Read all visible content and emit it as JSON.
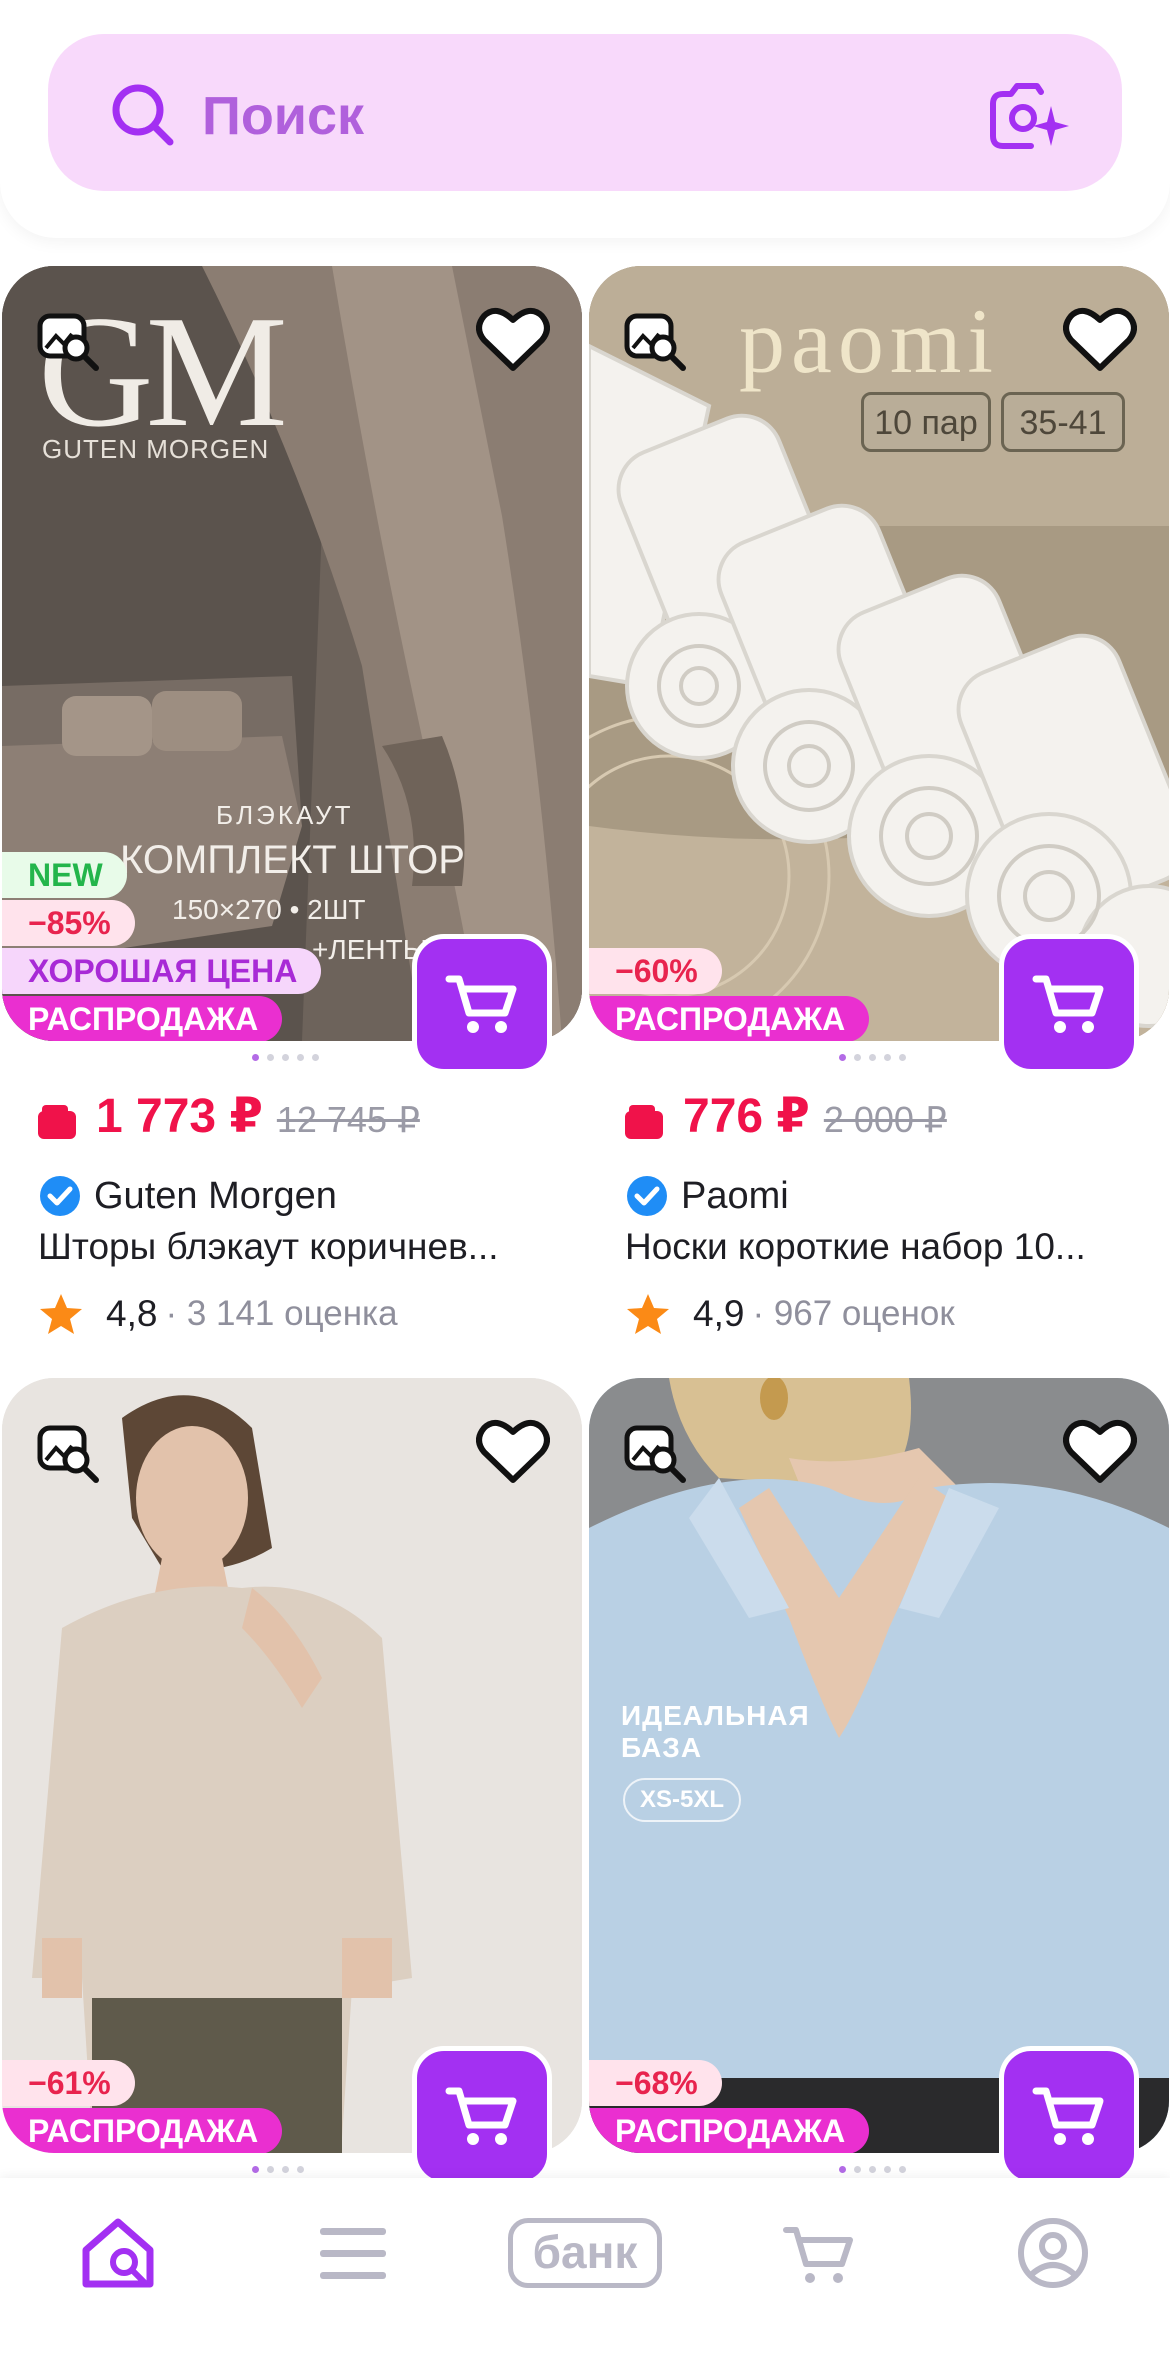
{
  "search": {
    "placeholder": "Поиск"
  },
  "colors": {
    "accent": "#a330f2",
    "price": "#f0124a",
    "sale_badge": "#ea2fd0",
    "search_bg": "#f8d9fb"
  },
  "products": [
    {
      "image_text": {
        "logo": "GM",
        "logo_sub": "GUTEN MORGEN",
        "line1": "БЛЭКАУТ",
        "line2": "КОМПЛЕКТ ШТОР",
        "line3": "150×270 • 2ШТ",
        "line4": "+ЛЕНТЫ"
      },
      "badges": [
        "NEW",
        "−85%",
        "ХОРОШАЯ ЦЕНА",
        "РАСПРОДАЖА"
      ],
      "price": "1 773 ₽",
      "old_price": "12 745 ₽",
      "brand": "Guten Morgen",
      "title": "Шторы блэкаут коричнев...",
      "rating": "4,8",
      "reviews": "· 3 141 оценка"
    },
    {
      "image_text": {
        "logo": "paomi",
        "pack": "10 пар",
        "size": "35-41"
      },
      "badges": [
        "−60%",
        "РАСПРОДАЖА"
      ],
      "price": "776 ₽",
      "old_price": "2 000 ₽",
      "brand": "Paomi",
      "title": "Носки короткие набор 10...",
      "rating": "4,9",
      "reviews": "· 967 оценок"
    },
    {
      "image_text": {},
      "badges": [
        "−61%",
        "РАСПРОДАЖА"
      ]
    },
    {
      "image_text": {
        "line1": "ИДЕАЛЬНАЯ",
        "line2": "БАЗА",
        "size": "XS-5XL"
      },
      "badges": [
        "−68%",
        "РАСПРОДАЖА"
      ]
    }
  ],
  "bottom_nav": {
    "bank": "банк",
    "items": [
      "home-icon",
      "menu-icon",
      "bank",
      "cart-icon",
      "profile-icon"
    ]
  }
}
